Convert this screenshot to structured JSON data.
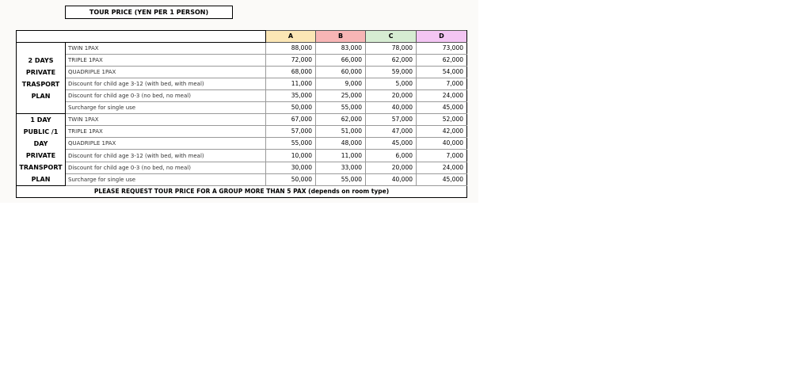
{
  "title": "TOUR PRICE (YEN PER 1 PERSON)",
  "columns": [
    {
      "label": "A",
      "color": "#fbe6b5"
    },
    {
      "label": "B",
      "color": "#f7b5b5"
    },
    {
      "label": "C",
      "color": "#d6ecd2"
    },
    {
      "label": "D",
      "color": "#f3c5f3"
    }
  ],
  "plans": [
    {
      "name_lines": [
        "2 DAYS",
        "PRIVATE",
        "TRASPORT",
        "PLAN"
      ],
      "rows": [
        {
          "label": "TWIN 1PAX",
          "values": [
            "88,000",
            "83,000",
            "78,000",
            "73,000"
          ]
        },
        {
          "label": "TRIPLE 1PAX",
          "values": [
            "72,000",
            "66,000",
            "62,000",
            "62,000"
          ]
        },
        {
          "label": "QUADRIPLE  1PAX",
          "values": [
            "68,000",
            "60,000",
            "59,000",
            "54,000"
          ]
        },
        {
          "label": "Discount for child age 3-12 (with bed, with meal)",
          "values": [
            "11,000",
            "9,000",
            "5,000",
            "7,000"
          ]
        },
        {
          "label": "Discount for child age 0-3 (no bed, no meal)",
          "values": [
            "35,000",
            "25,000",
            "20,000",
            "24,000"
          ]
        },
        {
          "label": "Surcharge for single use",
          "values": [
            "50,000",
            "55,000",
            "40,000",
            "45,000"
          ]
        }
      ]
    },
    {
      "name_lines": [
        "1 DAY",
        "PUBLIC /1",
        "DAY",
        "PRIVATE",
        "TRANSPORT",
        "PLAN"
      ],
      "rows": [
        {
          "label": "TWIN 1PAX",
          "values": [
            "67,000",
            "62,000",
            "57,000",
            "52,000"
          ]
        },
        {
          "label": "TRIPLE 1PAX",
          "values": [
            "57,000",
            "51,000",
            "47,000",
            "42,000"
          ]
        },
        {
          "label": "QUADRIPLE  1PAX",
          "values": [
            "55,000",
            "48,000",
            "45,000",
            "40,000"
          ]
        },
        {
          "label": "Discount for child age 3-12 (with bed, with meal)",
          "values": [
            "10,000",
            "11,000",
            "6,000",
            "7,000"
          ]
        },
        {
          "label": "Discount for child age 0-3 (no bed, no meal)",
          "values": [
            "30,000",
            "33,000",
            "20,000",
            "24,000"
          ]
        },
        {
          "label": "Surcharge for single use",
          "values": [
            "50,000",
            "55,000",
            "40,000",
            "45,000"
          ]
        }
      ]
    }
  ],
  "footer": "PLEASE REQUEST TOUR PRICE FOR A GROUP MORE THAN 5 PAX (depends on room type)"
}
